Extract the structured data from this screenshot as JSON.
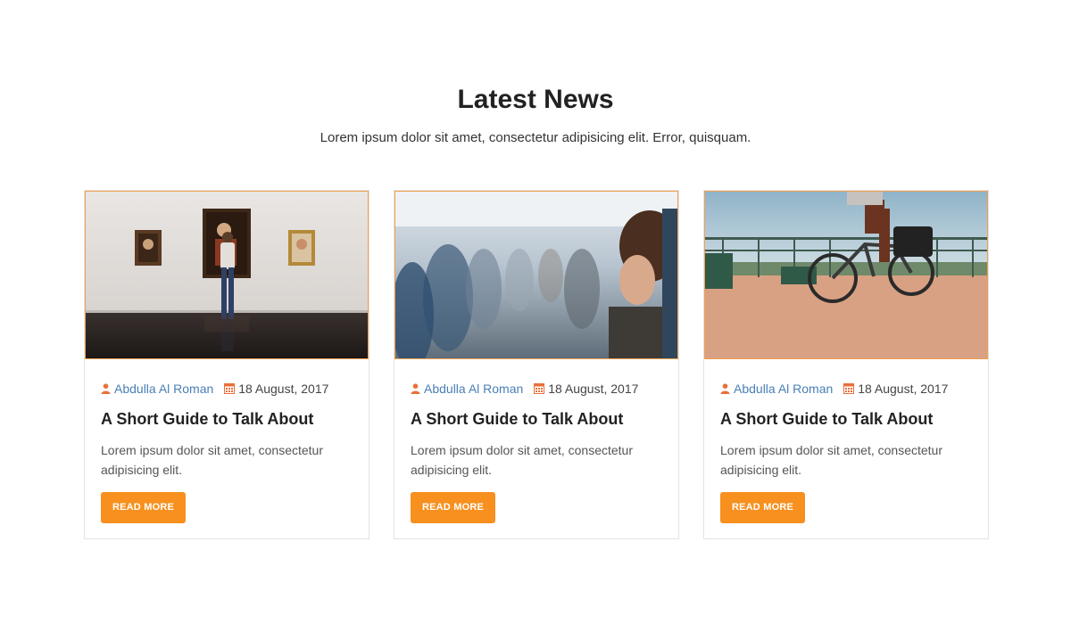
{
  "section": {
    "title": "Latest News",
    "subtitle": "Lorem ipsum dolor sit amet, consectetur adipisicing elit. Error, quisquam."
  },
  "colors": {
    "accent": "#f7901e",
    "author_link": "#4a7fb5",
    "meta_icon": "#e8703a"
  },
  "posts": [
    {
      "image": "art-gallery-photo",
      "author": "Abdulla Al Roman",
      "author_icon": "user-icon",
      "date": "18 August, 2017",
      "date_icon": "calendar-icon",
      "title": "A Short Guide to Talk About",
      "excerpt": "Lorem ipsum dolor sit amet, consectetur adipisicing elit.",
      "button_label": "READ MORE"
    },
    {
      "image": "airplane-cabin-photo",
      "author": "Abdulla Al Roman",
      "author_icon": "user-icon",
      "date": "18 August, 2017",
      "date_icon": "calendar-icon",
      "title": "A Short Guide to Talk About",
      "excerpt": "Lorem ipsum dolor sit amet, consectetur adipisicing elit.",
      "button_label": "READ MORE"
    },
    {
      "image": "cyclist-photo",
      "author": "Abdulla Al Roman",
      "author_icon": "user-icon",
      "date": "18 August, 2017",
      "date_icon": "calendar-icon",
      "title": "A Short Guide to Talk About",
      "excerpt": "Lorem ipsum dolor sit amet, consectetur adipisicing elit.",
      "button_label": "READ MORE"
    }
  ]
}
